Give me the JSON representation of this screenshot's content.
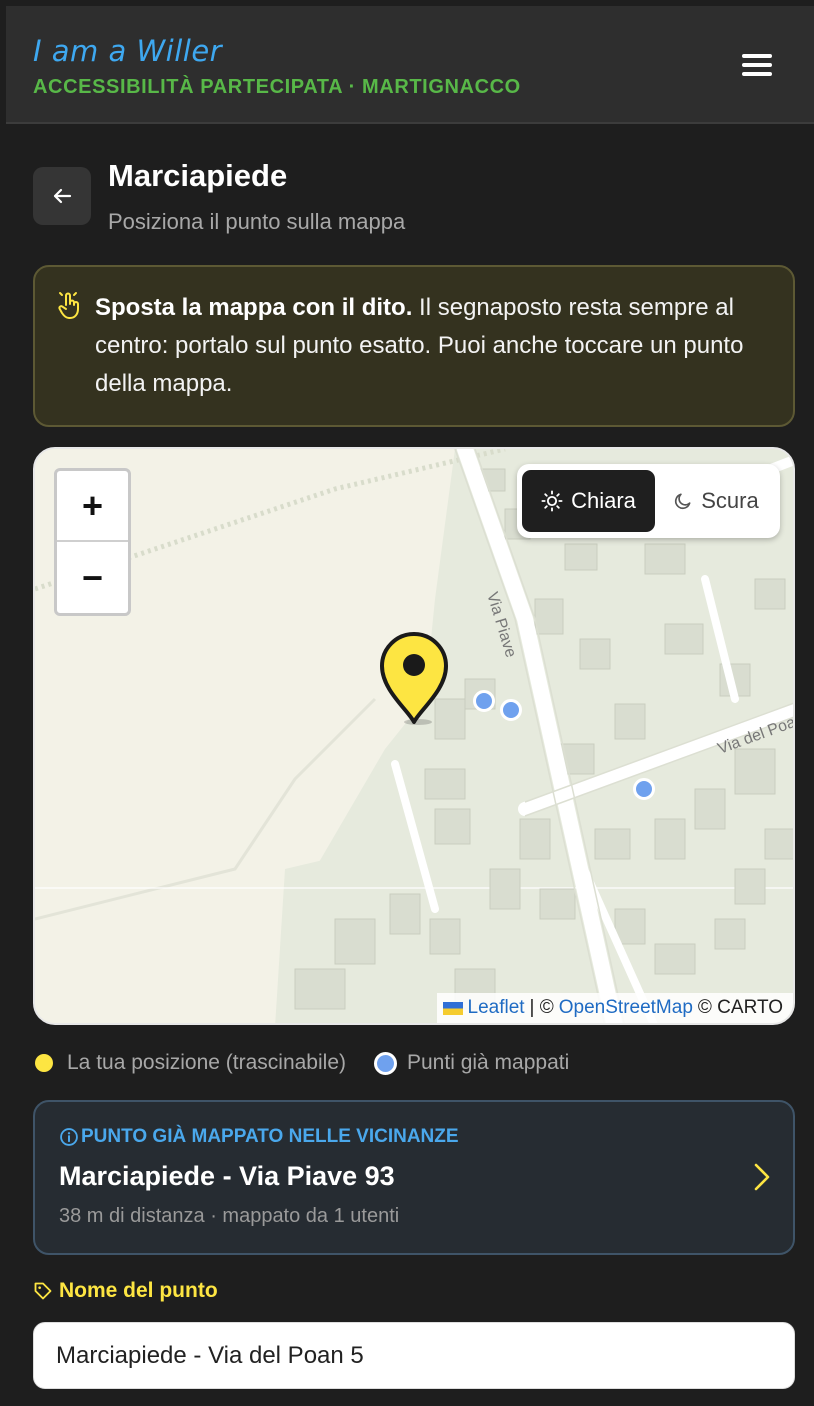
{
  "header": {
    "brand": "I am a Willer",
    "tagline": "ACCESSIBILITÀ PARTECIPATA · MARTIGNACCO",
    "menu_icon": "hamburger-menu-icon"
  },
  "page": {
    "title": "Marciapiede",
    "subtitle": "Posiziona il punto sulla mappa",
    "back_icon": "arrow-left-icon"
  },
  "hint": {
    "icon": "hand-pointer-icon",
    "bold": "Sposta la mappa con il dito.",
    "text": " Il segnaposto resta sempre al centro: portalo sul punto esatto. Puoi anche toccare un punto della mappa."
  },
  "map": {
    "zoom_in": "+",
    "zoom_out": "−",
    "theme_light": "Chiara",
    "theme_dark": "Scura",
    "street_1": "Via Piave",
    "street_2": "Via del Poan",
    "attrib_leaflet": "Leaflet",
    "attrib_sep": "| ©",
    "attrib_osm": "OpenStreetMap",
    "attrib_carto": "© CARTO"
  },
  "legend": {
    "position": "La tua posizione (trascinabile)",
    "mapped": "Punti già mappati"
  },
  "nearby": {
    "heading": "PUNTO GIÀ MAPPATO NELLE VICINANZE",
    "title": "Marciapiede - Via Piave 93",
    "meta": "38 m di distanza · mappato da 1 utenti"
  },
  "form": {
    "name_label": "Nome del punto",
    "name_value": "Marciapiede - Via del Poan 5"
  },
  "colors": {
    "accent_yellow": "#fde542",
    "accent_blue": "#4aa8ec",
    "brand_green": "#58b848",
    "background": "#1e1e1e"
  }
}
